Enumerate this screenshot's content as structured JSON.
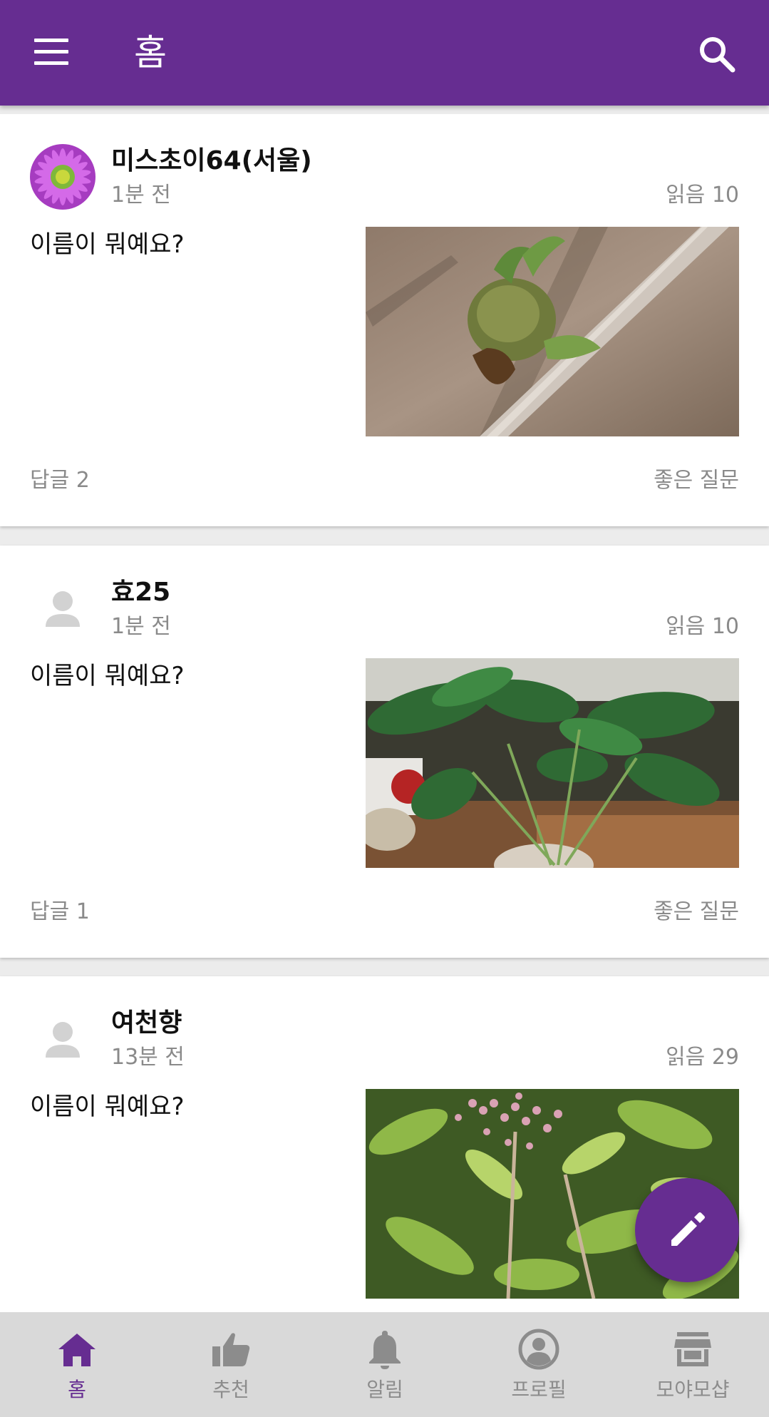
{
  "header": {
    "title": "홈",
    "menu_icon": "hamburger-menu-icon",
    "search_icon": "search-icon"
  },
  "posts": [
    {
      "username": "미스초이64(서울)",
      "time": "1분 전",
      "reads": "읽음 10",
      "question": "이름이 뭐예요?",
      "replies": "답글 2",
      "good_question": "좋은 질문",
      "avatar": "flower-avatar"
    },
    {
      "username": "효25",
      "time": "1분 전",
      "reads": "읽음 10",
      "question": "이름이 뭐예요?",
      "replies": "답글 1",
      "good_question": "좋은 질문",
      "avatar": "default-person-avatar"
    },
    {
      "username": "여천향",
      "time": "13분 전",
      "reads": "읽음 29",
      "question": "이름이 뭐예요?",
      "avatar": "default-person-avatar"
    }
  ],
  "fab": {
    "icon": "pencil-icon"
  },
  "bottom_nav": [
    {
      "label": "홈",
      "icon": "home-icon",
      "active": true
    },
    {
      "label": "추천",
      "icon": "thumbs-up-icon",
      "active": false
    },
    {
      "label": "알림",
      "icon": "bell-icon",
      "active": false
    },
    {
      "label": "프로필",
      "icon": "profile-icon",
      "active": false
    },
    {
      "label": "모야모샵",
      "icon": "store-icon",
      "active": false
    }
  ],
  "colors": {
    "primary": "#662d91",
    "background": "#ececec",
    "secondary_text": "#8a8a8a",
    "nav_bg": "#d9d9d9",
    "nav_inactive": "#8c8c8c"
  }
}
